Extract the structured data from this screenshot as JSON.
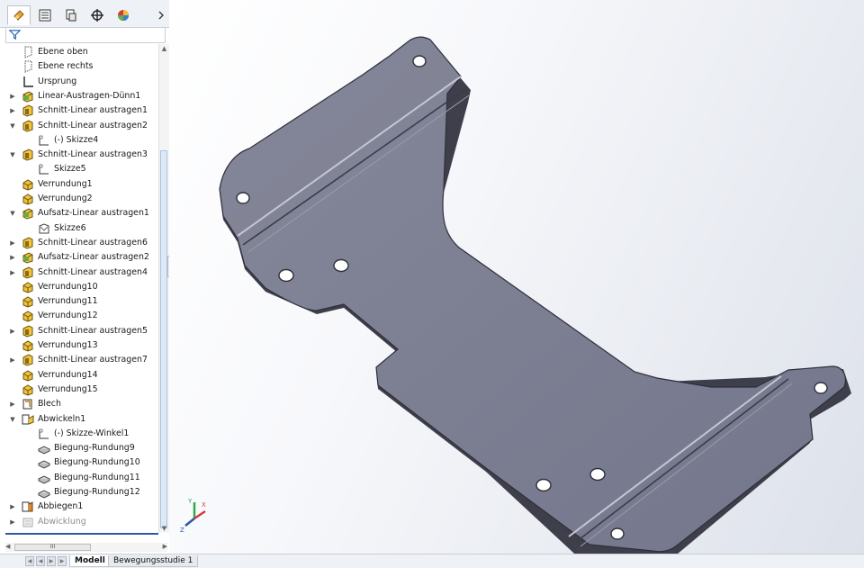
{
  "panel_tabs": [
    {
      "name": "featuremanager-tab-icon",
      "active": true
    },
    {
      "name": "propertymanager-tab-icon",
      "active": false
    },
    {
      "name": "configurationmanager-tab-icon",
      "active": false
    },
    {
      "name": "dimxpert-tab-icon",
      "active": false
    },
    {
      "name": "displaymanager-tab-icon",
      "active": false
    }
  ],
  "tree": [
    {
      "label": "Ebene oben",
      "icon": "plane-icon",
      "indent": 1,
      "expander": ""
    },
    {
      "label": "Ebene rechts",
      "icon": "plane-icon",
      "indent": 1,
      "expander": ""
    },
    {
      "label": "Ursprung",
      "icon": "origin-icon",
      "indent": 1,
      "expander": ""
    },
    {
      "label": "Linear-Austragen-Dünn1",
      "icon": "extrude-boss-icon",
      "indent": 1,
      "expander": "collapsed"
    },
    {
      "label": "Schnitt-Linear austragen1",
      "icon": "extrude-cut-icon",
      "indent": 1,
      "expander": "collapsed"
    },
    {
      "label": "Schnitt-Linear austragen2",
      "icon": "extrude-cut-icon",
      "indent": 1,
      "expander": "expanded"
    },
    {
      "label": "(-) Skizze4",
      "icon": "sketch-icon",
      "indent": 2,
      "expander": ""
    },
    {
      "label": "Schnitt-Linear austragen3",
      "icon": "extrude-cut-icon",
      "indent": 1,
      "expander": "expanded"
    },
    {
      "label": "Skizze5",
      "icon": "sketch-icon",
      "indent": 2,
      "expander": ""
    },
    {
      "label": "Verrundung1",
      "icon": "fillet-icon",
      "indent": 1,
      "expander": ""
    },
    {
      "label": "Verrundung2",
      "icon": "fillet-icon",
      "indent": 1,
      "expander": ""
    },
    {
      "label": "Aufsatz-Linear austragen1",
      "icon": "extrude-boss-icon",
      "indent": 1,
      "expander": "expanded"
    },
    {
      "label": "Skizze6",
      "icon": "sketch-3d-icon",
      "indent": 2,
      "expander": ""
    },
    {
      "label": "Schnitt-Linear austragen6",
      "icon": "extrude-cut-icon",
      "indent": 1,
      "expander": "collapsed"
    },
    {
      "label": "Aufsatz-Linear austragen2",
      "icon": "extrude-boss-icon",
      "indent": 1,
      "expander": "collapsed"
    },
    {
      "label": "Schnitt-Linear austragen4",
      "icon": "extrude-cut-icon",
      "indent": 1,
      "expander": "collapsed"
    },
    {
      "label": "Verrundung10",
      "icon": "fillet-icon",
      "indent": 1,
      "expander": ""
    },
    {
      "label": "Verrundung11",
      "icon": "fillet-icon",
      "indent": 1,
      "expander": ""
    },
    {
      "label": "Verrundung12",
      "icon": "fillet-icon",
      "indent": 1,
      "expander": ""
    },
    {
      "label": "Schnitt-Linear austragen5",
      "icon": "extrude-cut-icon",
      "indent": 1,
      "expander": "collapsed"
    },
    {
      "label": "Verrundung13",
      "icon": "fillet-icon",
      "indent": 1,
      "expander": ""
    },
    {
      "label": "Schnitt-Linear austragen7",
      "icon": "extrude-cut-icon",
      "indent": 1,
      "expander": "collapsed"
    },
    {
      "label": "Verrundung14",
      "icon": "fillet-icon",
      "indent": 1,
      "expander": ""
    },
    {
      "label": "Verrundung15",
      "icon": "fillet-icon",
      "indent": 1,
      "expander": ""
    },
    {
      "label": "Blech",
      "icon": "sheetmetal-icon",
      "indent": 1,
      "expander": "collapsed"
    },
    {
      "label": "Abwickeln1",
      "icon": "unfold-icon",
      "indent": 1,
      "expander": "expanded"
    },
    {
      "label": "(-) Skizze-Winkel1",
      "icon": "sketch-icon",
      "indent": 2,
      "expander": ""
    },
    {
      "label": "Biegung-Rundung9",
      "icon": "bend-icon",
      "indent": 2,
      "expander": ""
    },
    {
      "label": "Biegung-Rundung10",
      "icon": "bend-icon",
      "indent": 2,
      "expander": ""
    },
    {
      "label": "Biegung-Rundung11",
      "icon": "bend-icon",
      "indent": 2,
      "expander": ""
    },
    {
      "label": "Biegung-Rundung12",
      "icon": "bend-icon",
      "indent": 2,
      "expander": ""
    },
    {
      "label": "Abbiegen1",
      "icon": "fold-icon",
      "indent": 1,
      "expander": "collapsed"
    },
    {
      "label": "Abwicklung",
      "icon": "flat-pattern-icon",
      "indent": 1,
      "expander": "collapsed",
      "suppressed": true
    }
  ],
  "hscroll_thumb_glyph": "III",
  "bottom_tabs": [
    {
      "label": "Modell",
      "active": true
    },
    {
      "label": "Bewegungsstudie 1",
      "active": false
    }
  ],
  "triad": {
    "x": "X",
    "y": "Y",
    "z": "Z"
  },
  "colors": {
    "part_face": "#7b7d93",
    "part_edge": "#3a3a48",
    "selection_blue": "#2a5aa8",
    "fillet_yellow": "#e8c23a",
    "boss_green": "#5fb04a"
  }
}
